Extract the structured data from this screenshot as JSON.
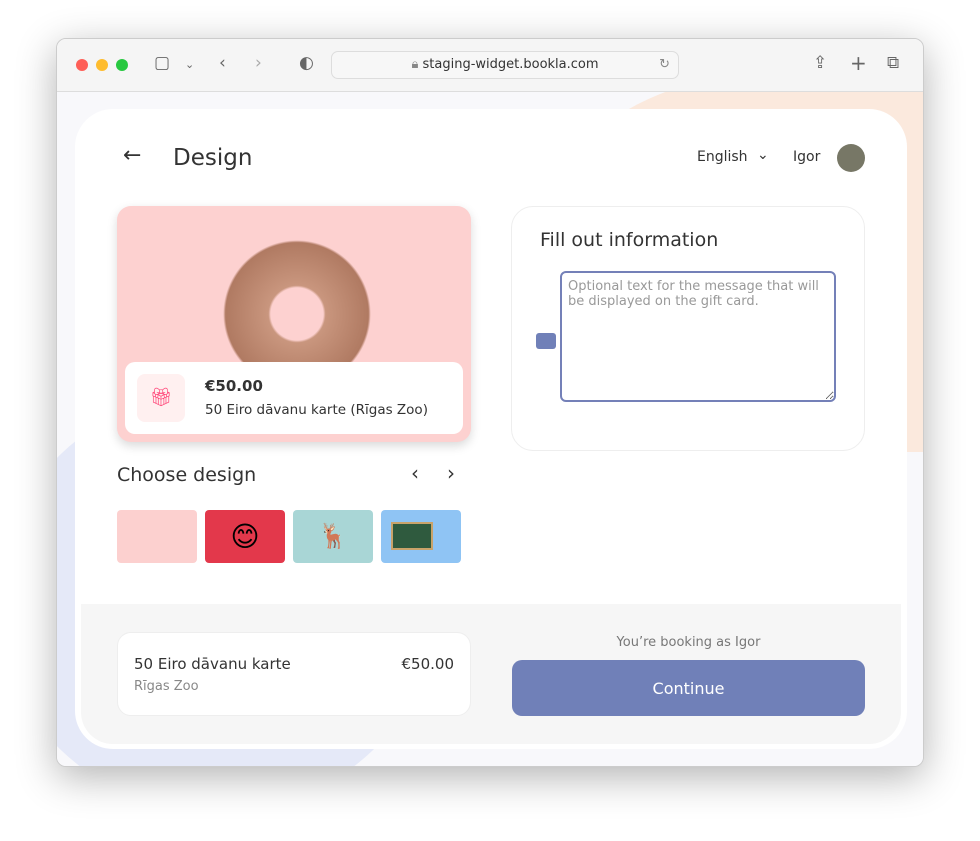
{
  "browser": {
    "url": "staging-widget.bookla.com"
  },
  "header": {
    "title": "Design",
    "language": "English",
    "user": "Igor"
  },
  "card": {
    "price": "€50.00",
    "name": "50 Eiro dāvanu karte (Rīgas Zoo)"
  },
  "designs": {
    "title": "Choose design",
    "items": [
      "hands-heart",
      "smiley-hearts",
      "reindeer",
      "teacher"
    ]
  },
  "form": {
    "title": "Fill out information",
    "message_placeholder": "Optional text for the message that will be displayed on the gift card.",
    "message_value": ""
  },
  "footer": {
    "product": "50 Eiro dāvanu karte",
    "venue": "Rīgas Zoo",
    "price": "€50.00",
    "booking_as": "You’re booking as Igor",
    "continue": "Continue"
  },
  "colors": {
    "accent": "#7080b8",
    "hero_bg": "#fdd1d0"
  }
}
